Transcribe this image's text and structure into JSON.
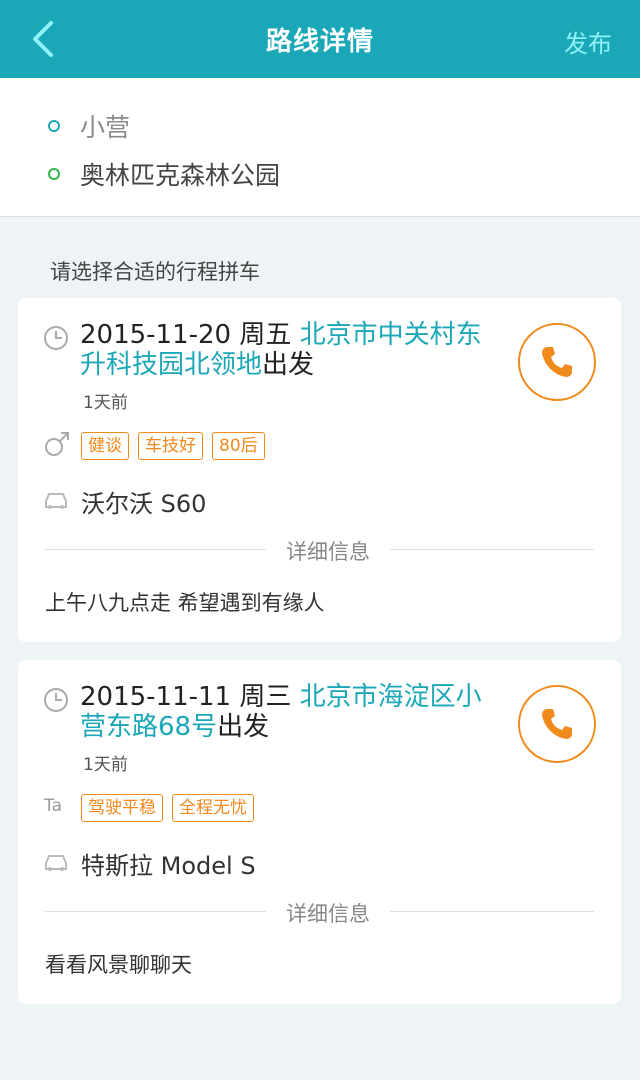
{
  "header": {
    "title": "路线详情",
    "publish_label": "发布"
  },
  "route": {
    "start": "小营",
    "end": "奥林匹克森林公园"
  },
  "section_label": "请选择合适的行程拼车",
  "trips": [
    {
      "date": "2015-11-20 周五",
      "place": "北京市中关村东升科技园北领地",
      "suffix": "出发",
      "ago": "1天前",
      "tags": [
        "健谈",
        "车技好",
        "80后"
      ],
      "car": "沃尔沃 S60",
      "divider_label": "详细信息",
      "note": "上午八九点走 希望遇到有缘人",
      "profile_icon": "male-icon"
    },
    {
      "date": "2015-11-11 周三",
      "place": "北京市海淀区小营东路68号",
      "suffix": "出发",
      "ago": "1天前",
      "tags": [
        "驾驶平稳",
        "全程无忧"
      ],
      "car": "特斯拉 Model S",
      "divider_label": "详细信息",
      "note": "看看风景聊聊天",
      "profile_icon": "text-size-icon",
      "profile_icon_text": "Ta"
    }
  ],
  "colors": {
    "accent": "#1aa7b8",
    "orange": "#f08a1c",
    "green": "#2fb84a"
  }
}
